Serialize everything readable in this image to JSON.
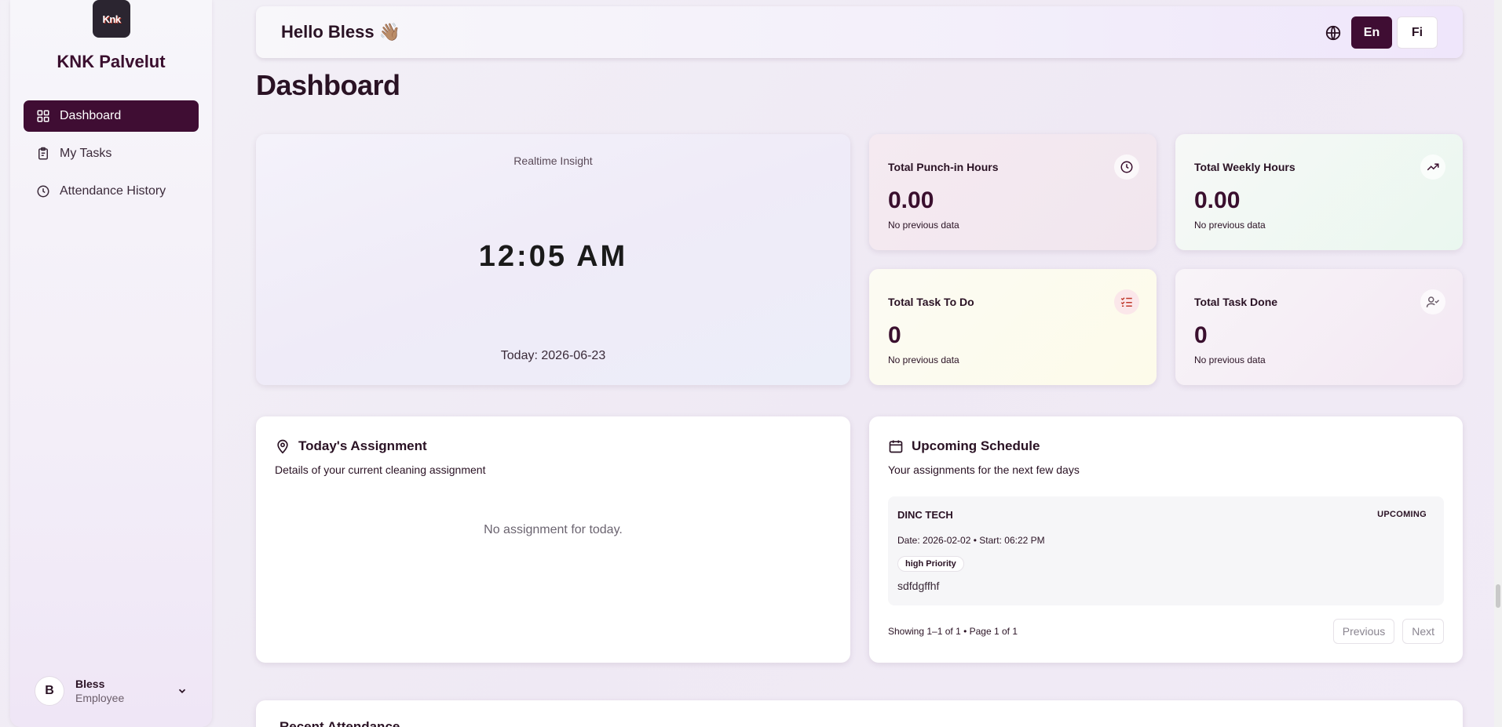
{
  "sidebar": {
    "logo_text": "Knk",
    "brand": "KNK Palvelut",
    "items": [
      {
        "label": "Dashboard",
        "icon": "grid-icon",
        "active": true
      },
      {
        "label": "My Tasks",
        "icon": "clipboard-icon"
      },
      {
        "label": "Attendance History",
        "icon": "clock-icon"
      }
    ],
    "user": {
      "initial": "B",
      "name": "Bless",
      "role": "Employee"
    }
  },
  "header": {
    "greeting": "Hello Bless 👋🏽",
    "languages": [
      "En",
      "Fi"
    ],
    "active_language": "En"
  },
  "page_title": "Dashboard",
  "insight": {
    "label": "Realtime Insight",
    "time": "12:05 AM",
    "date": "Today: 2026-06-23"
  },
  "stats": [
    {
      "title": "Total Punch-in Hours",
      "value": "0.00",
      "sub": "No previous data",
      "icon": "clock-icon"
    },
    {
      "title": "Total Weekly Hours",
      "value": "0.00",
      "sub": "No previous data",
      "icon": "trending-up-icon"
    },
    {
      "title": "Total Task To Do",
      "value": "0",
      "sub": "No previous data",
      "icon": "list-checks-icon"
    },
    {
      "title": "Total Task Done",
      "value": "0",
      "sub": "No previous data",
      "icon": "user-check-icon"
    }
  ],
  "assignment": {
    "title": "Today's Assignment",
    "description": "Details of your current cleaning assignment",
    "empty": "No assignment for today."
  },
  "schedule": {
    "title": "Upcoming Schedule",
    "description": "Your assignments for the next few days",
    "items": [
      {
        "name": "DINC TECH",
        "status": "UPCOMING",
        "meta": "Date: 2026-02-02 • Start: 06:22 PM",
        "priority": "high Priority",
        "note": "sdfdgffhf"
      }
    ],
    "pager_info": "Showing 1–1 of 1 • Page 1 of 1",
    "prev_label": "Previous",
    "next_label": "Next"
  },
  "recent": {
    "title": "Recent Attendance"
  },
  "colors": {
    "primary": "#3f0d33",
    "text": "#2a1224",
    "accent_red": "#c0392b"
  }
}
